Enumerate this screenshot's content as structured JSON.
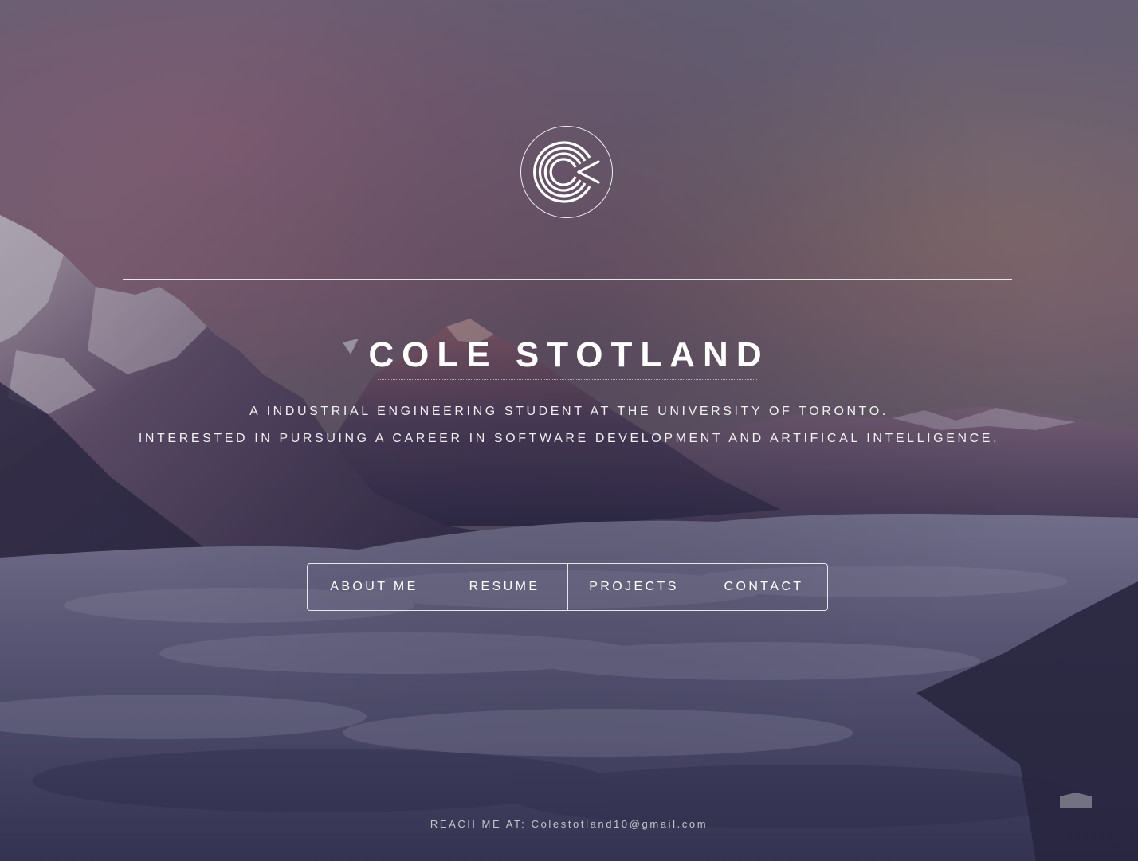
{
  "header": {
    "name": "COLE STOTLAND",
    "tagline_line1": "A INDUSTRIAL ENGINEERING STUDENT AT THE UNIVERSITY OF TORONTO.",
    "tagline_line2": "INTERESTED IN PURSUING A CAREER IN SOFTWARE DEVELOPMENT AND ARTIFICAL INTELLIGENCE."
  },
  "logo": {
    "icon": "c-monogram-icon"
  },
  "nav": {
    "items": [
      {
        "label": "ABOUT ME"
      },
      {
        "label": "RESUME"
      },
      {
        "label": "PROJECTS"
      },
      {
        "label": "CONTACT"
      }
    ]
  },
  "footer": {
    "prefix": "REACH ME AT:",
    "email": "Colestotland10@gmail.com"
  },
  "colors": {
    "sky_top": "#7d7189",
    "sky_pink": "#9b6e84",
    "clouds": "#4a4768",
    "text": "#ffffff"
  }
}
